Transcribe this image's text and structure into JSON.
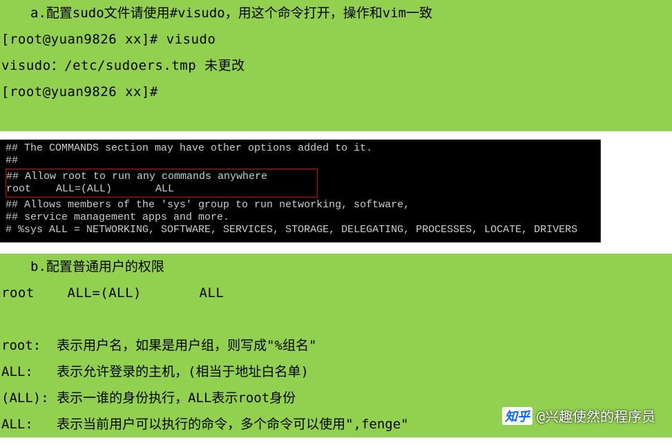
{
  "sectionA": {
    "header": "a.配置sudo文件请使用#visudo，用这个命令打开，操作和vim一致",
    "lines": [
      "[root@yuan9826 xx]# visudo",
      "visudo：/etc/sudoers.tmp 未更改",
      "[root@yuan9826 xx]#"
    ]
  },
  "terminal": {
    "l1": "## The COMMANDS section may have other options added to it.",
    "l2": "##",
    "boxed": {
      "b1": "## Allow root to run any commands anywhere",
      "b2": "root    ALL=(ALL)       ALL"
    },
    "l3": "## Allows members of the 'sys' group to run networking, software,",
    "l4": "## service management apps and more.",
    "l5": "# %sys ALL = NETWORKING, SOFTWARE, SERVICES, STORAGE, DELEGATING, PROCESSES, LOCATE, DRIVERS"
  },
  "sectionB": {
    "title": "b.配置普通用户的权限",
    "rule": "root    ALL=(ALL)       ALL"
  },
  "explain": {
    "r1": "root:  表示用户名，如果是用户组，则写成\"%组名\"",
    "r2": "ALL:   表示允许登录的主机，(相当于地址白名单)",
    "r3": "(ALL): 表示一谁的身份执行，ALL表示root身份",
    "r4": "ALL:   表示当前用户可以执行的命令，多个命令可以使用\",fenge\""
  },
  "watermark": {
    "logo": "知乎",
    "text": "@兴趣使然的程序员"
  }
}
